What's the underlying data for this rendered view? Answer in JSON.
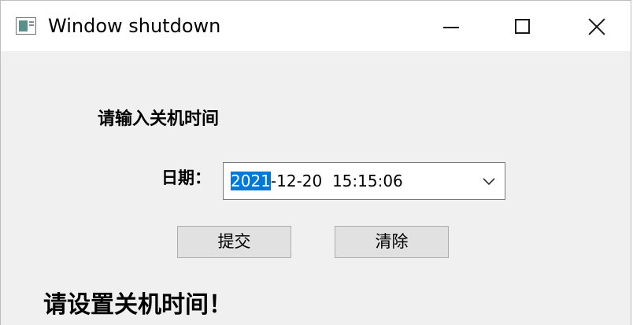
{
  "window": {
    "title": "Window shutdown"
  },
  "form": {
    "prompt": "请输入关机时间",
    "date_label": "日期：",
    "date_value": {
      "selected": "2021",
      "rest": "-12-20  15:15:06"
    },
    "submit_label": "提交",
    "clear_label": "清除"
  },
  "status": {
    "message": "请设置关机时间！"
  },
  "icons": {
    "app": "app-window-icon",
    "minimize": "minimize-icon",
    "maximize": "maximize-icon",
    "close": "close-icon",
    "dropdown": "chevron-down-icon"
  },
  "colors": {
    "selection": "#0078d7",
    "button_face": "#e1e1e1",
    "window_background": "#f0f0f0"
  }
}
